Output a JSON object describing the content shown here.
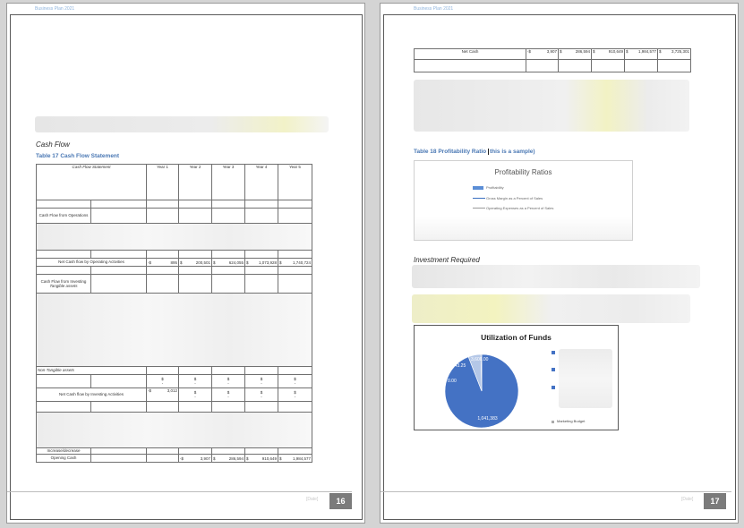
{
  "left_page": {
    "header": "Business Plan 2021",
    "section_heading": "Cash Flow",
    "table_caption": "Table 17 Cash Flow Statement",
    "table_title": "Cash Flow Statement",
    "years": [
      "Year 1",
      "Year 2",
      "Year 3",
      "Year 4",
      "Year 5"
    ],
    "labels": {
      "ops": "Cash Flow from Operations",
      "net_ops": "Net Cash flow by Operating Activities",
      "invest": "Cash Flow from Investing",
      "tangible": "Tangible assets",
      "non_tangible": "Non-Tangible assets",
      "net_invest": "Net Cash flow by Investing Activities",
      "incdec": "Increase/decrease",
      "opening": "Opening Cash"
    },
    "net_ops_values": [
      "895",
      "200,501",
      "624,055",
      "1,073,928",
      "1,740,724"
    ],
    "net_ops_first_sign": "-$",
    "currency": "$",
    "dash": "-",
    "net_invest_first_value": "3,012",
    "net_invest_first_sign": "-$",
    "opening_values": [
      "3,907",
      "286,594",
      "910,649",
      "1,984,577"
    ],
    "opening_first_sign": "-$",
    "footer_date": "[Date]",
    "page_number": "16"
  },
  "right_page": {
    "header": "Business Plan 2021",
    "net_cash_label": "Net Cash",
    "net_cash_values": [
      "3,907",
      "286,594",
      "910,649",
      "1,984,577",
      "3,725,301"
    ],
    "net_cash_first_sign": "-$",
    "currency": "$",
    "table_caption_prefix": "Table 18 Profitability Ratio",
    "table_caption_suffix": "this is a sample)",
    "ratio_chart_title": "Profitability Ratios",
    "ratio_legend": [
      "Profitability",
      "Gross Margin as a Percent of Sales",
      "Operating Expenses as a Percent of Sales"
    ],
    "investment_heading": "Investment Required",
    "footer_date": "[Date]",
    "page_number": "17"
  },
  "chart_data": {
    "type": "pie",
    "title": "Utilization of Funds",
    "data_labels": [
      "1,041,383",
      "61,543.25",
      "0.00",
      "3,600.00"
    ],
    "slices": [
      {
        "label": "1,041,383",
        "value": 1041383,
        "color": "#4472c4"
      },
      {
        "label": "61,543.25",
        "value": 61543.25,
        "color": "#b4c7e7"
      },
      {
        "label": "0.00",
        "value": 0,
        "color": "#7f9fd6"
      },
      {
        "label": "3,600.00",
        "value": 3600,
        "color": "#2f5597"
      }
    ],
    "legend_visible": [
      "Marketing Budget"
    ],
    "legend_position": "right"
  }
}
